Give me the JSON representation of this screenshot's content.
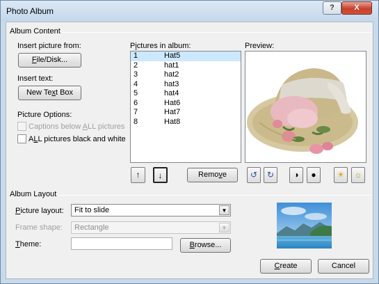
{
  "window": {
    "title": "Photo Album",
    "help_label": "?",
    "close_label": "X"
  },
  "album_content": {
    "group_label": "Album Content",
    "insert_picture_label": "Insert picture from:",
    "file_disk_button": "File/Disk...",
    "insert_text_label": "Insert text:",
    "new_text_box_button": "New Text Box",
    "picture_options_label": "Picture Options:",
    "captions_label": "Captions below ALL pictures",
    "captions_checked": false,
    "captions_enabled": false,
    "black_white_label": "ALL pictures black and white",
    "black_white_checked": false,
    "pictures_in_album_label": "Pictures in album:",
    "pictures": [
      {
        "num": "1",
        "name": "Hat5",
        "selected": true
      },
      {
        "num": "2",
        "name": "hat1",
        "selected": false
      },
      {
        "num": "3",
        "name": "hat2",
        "selected": false
      },
      {
        "num": "4",
        "name": "hat3",
        "selected": false
      },
      {
        "num": "5",
        "name": "hat4",
        "selected": false
      },
      {
        "num": "6",
        "name": "Hat6",
        "selected": false
      },
      {
        "num": "7",
        "name": "Hat7",
        "selected": false
      },
      {
        "num": "8",
        "name": "Hat8",
        "selected": false
      }
    ],
    "remove_button": "Remove",
    "preview_label": "Preview:",
    "move_up_icon": "arrow-up-icon",
    "move_down_icon": "arrow-down-icon"
  },
  "album_layout": {
    "group_label": "Album Layout",
    "picture_layout_label": "Picture layout:",
    "picture_layout_value": "Fit to slide",
    "frame_shape_label": "Frame shape:",
    "frame_shape_value": "Rectangle",
    "theme_label": "Theme:",
    "theme_value": "",
    "browse_button": "Browse..."
  },
  "footer": {
    "create_button": "Create",
    "cancel_button": "Cancel"
  },
  "colors": {
    "selection": "#cce8ff",
    "title_bar": "#c4d7ea",
    "close_button": "#c8402b"
  }
}
